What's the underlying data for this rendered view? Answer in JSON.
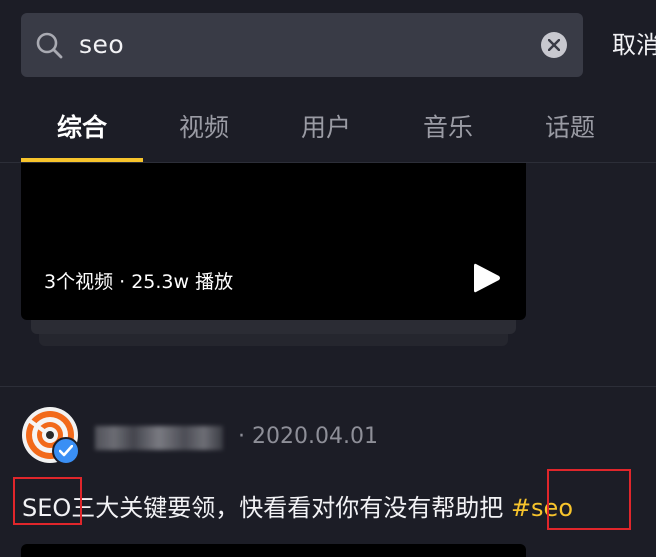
{
  "search": {
    "query": "seo",
    "cancel_label": "取消"
  },
  "tabs": [
    {
      "label": "综合",
      "active": true
    },
    {
      "label": "视频",
      "active": false
    },
    {
      "label": "用户",
      "active": false
    },
    {
      "label": "音乐",
      "active": false
    },
    {
      "label": "话题",
      "active": false
    }
  ],
  "video_card": {
    "meta": "3个视频 · 25.3w 播放"
  },
  "post": {
    "date_separator": "·",
    "date": "2020.04.01",
    "caption_keyword": "SEO",
    "caption_text": "三大关键要领，快看看对你有没有帮助把",
    "hashtag": "#seo"
  },
  "colors": {
    "accent": "#f7c42c",
    "highlight": "#e0262b",
    "verified": "#3a8ff5",
    "background": "#1c1d26"
  },
  "icons": [
    "search-icon",
    "clear-icon",
    "play-icon",
    "verified-icon"
  ]
}
